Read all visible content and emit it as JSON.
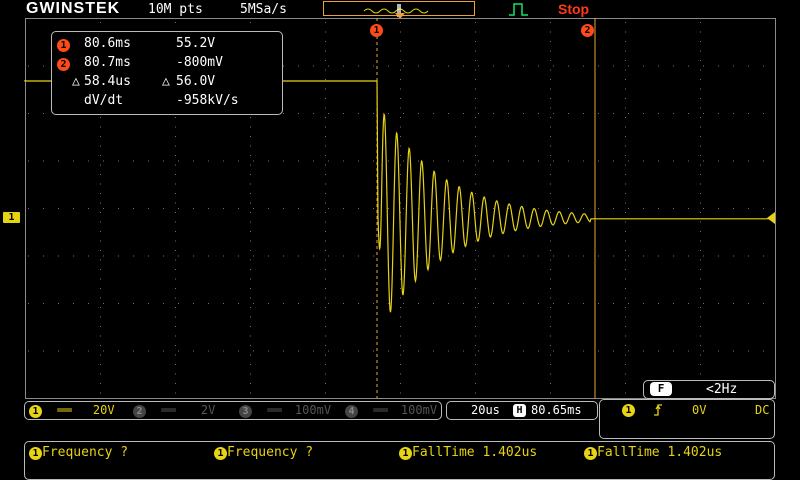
{
  "header": {
    "brand": "GWINSTEK",
    "memory_depth": "10M pts",
    "sample_rate": "5MSa/s",
    "status": "Stop"
  },
  "cursor_readout": {
    "c1_time": "80.6ms",
    "c1_volt": "55.2V",
    "c2_time": "80.7ms",
    "c2_volt": "-800mV",
    "dt": "58.4us",
    "dv": "56.0V",
    "dvdt_label": "dV/dt",
    "dvdt_value": "-958kV/s"
  },
  "markers": {
    "channel_1": "1",
    "cursor_1": "1",
    "cursor_2": "2"
  },
  "trigger_panel": {
    "mode": "F",
    "freq": "<2Hz",
    "source": "1",
    "level": "0V",
    "coupling": "DC"
  },
  "channels": [
    {
      "num": "1",
      "coupling": "══",
      "scale": "20V",
      "active": true
    },
    {
      "num": "2",
      "coupling": "══",
      "scale": "2V",
      "active": false
    },
    {
      "num": "3",
      "coupling": "══",
      "scale": "100mV",
      "active": false
    },
    {
      "num": "4",
      "coupling": "══",
      "scale": "100mV",
      "active": false
    }
  ],
  "timebase": {
    "scale": "20us",
    "h_icon": "H",
    "position": "80.65ms"
  },
  "measurements": [
    {
      "ch": "1",
      "label": "Frequency ?"
    },
    {
      "ch": "1",
      "label": "Frequency ?"
    },
    {
      "ch": "1",
      "label": "FallTime 1.402us"
    },
    {
      "ch": "1",
      "label": "FallTime 1.402us"
    }
  ],
  "colors": {
    "channel1": "#e6d313",
    "cursor": "#e8a23a",
    "grid": "#6a6a6a",
    "stop": "#ff3a1a",
    "trigger_icon": "#19e06a"
  },
  "waveform": {
    "baseline_before_volts": 56.0,
    "baseline_after_volts": 0.0,
    "damped_ringing": true
  }
}
